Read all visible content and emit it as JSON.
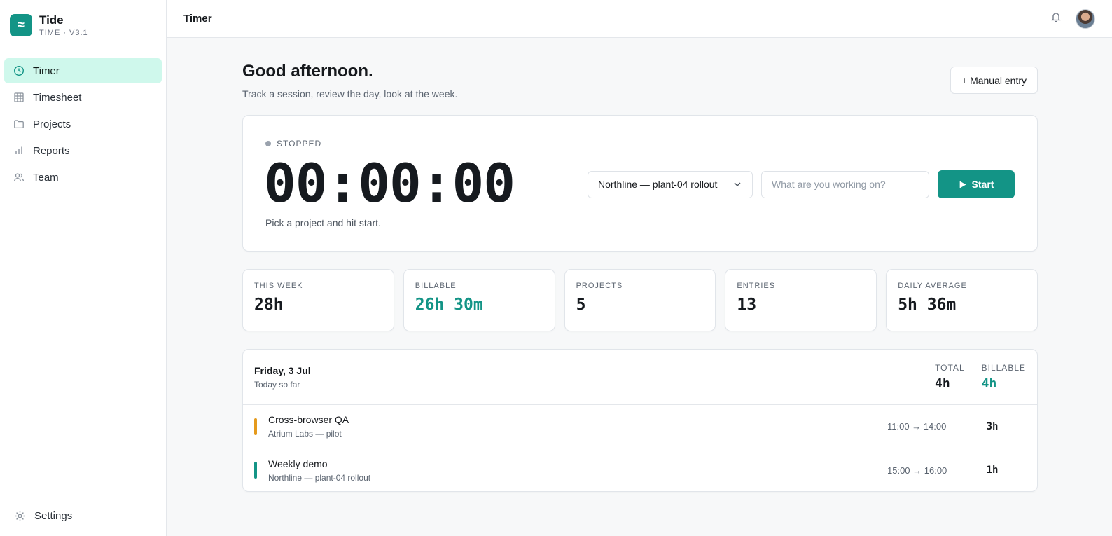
{
  "brand": {
    "name": "Tide",
    "subtitle": "TIME · V3.1",
    "logo_glyph": "≈",
    "accent": "#139486"
  },
  "sidebar": {
    "items": [
      {
        "label": "Timer",
        "icon": "clock-icon",
        "active": true
      },
      {
        "label": "Timesheet",
        "icon": "grid-icon",
        "active": false
      },
      {
        "label": "Projects",
        "icon": "folder-icon",
        "active": false
      },
      {
        "label": "Reports",
        "icon": "bar-chart-icon",
        "active": false
      },
      {
        "label": "Team",
        "icon": "users-icon",
        "active": false
      }
    ],
    "settings_label": "Settings"
  },
  "header": {
    "title": "Timer"
  },
  "greeting": {
    "title": "Good afternoon.",
    "subtitle": "Track a session, review the day, look at the week.",
    "manual_entry_label": "+ Manual entry"
  },
  "timer": {
    "status": "STOPPED",
    "display": "00:00:00",
    "hint": "Pick a project and hit start.",
    "project": "Northline — plant-04 rollout",
    "task_placeholder": "What are you working on?",
    "task_value": "",
    "start_label": "Start"
  },
  "stats": [
    {
      "label": "THIS WEEK",
      "value": "28h",
      "accent": false
    },
    {
      "label": "BILLABLE",
      "value": "26h 30m",
      "accent": true
    },
    {
      "label": "PROJECTS",
      "value": "5",
      "accent": false
    },
    {
      "label": "ENTRIES",
      "value": "13",
      "accent": false
    },
    {
      "label": "DAILY AVERAGE",
      "value": "5h 36m",
      "accent": false
    }
  ],
  "day": {
    "title": "Friday, 3 Jul",
    "subtitle": "Today so far",
    "total_label": "TOTAL",
    "total_value": "4h",
    "billable_label": "BILLABLE",
    "billable_value": "4h",
    "entries": [
      {
        "title": "Cross-browser QA",
        "project": "Atrium Labs — pilot",
        "time": "11:00 → 14:00",
        "duration": "3h",
        "color": "#e59a1c"
      },
      {
        "title": "Weekly demo",
        "project": "Northline — plant-04 rollout",
        "time": "15:00 → 16:00",
        "duration": "1h",
        "color": "#139486"
      }
    ]
  }
}
